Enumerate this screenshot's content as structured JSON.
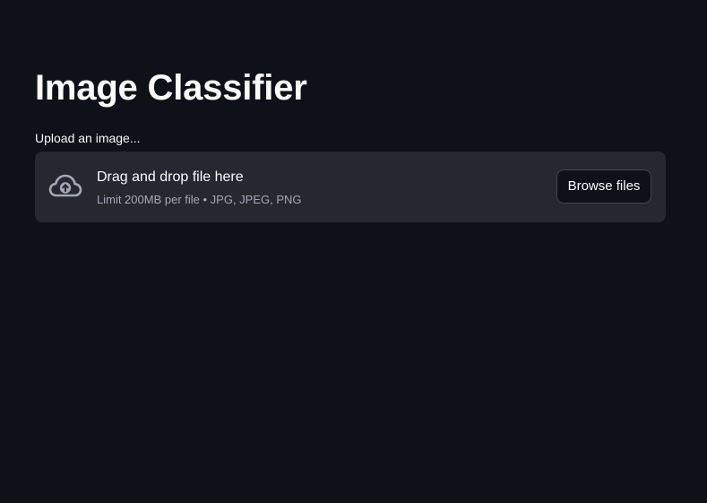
{
  "page": {
    "title": "Image Classifier"
  },
  "uploader": {
    "label": "Upload an image...",
    "drop_text": "Drag and drop file here",
    "limit_text": "Limit 200MB per file • JPG, JPEG, PNG",
    "browse_label": "Browse files",
    "icon": "cloud-upload-icon"
  },
  "colors": {
    "background": "#0e1117",
    "dropzone_background": "#262730",
    "text_primary": "#fafafa",
    "text_secondary": "#a3a8b8",
    "button_border": "#43464f"
  }
}
